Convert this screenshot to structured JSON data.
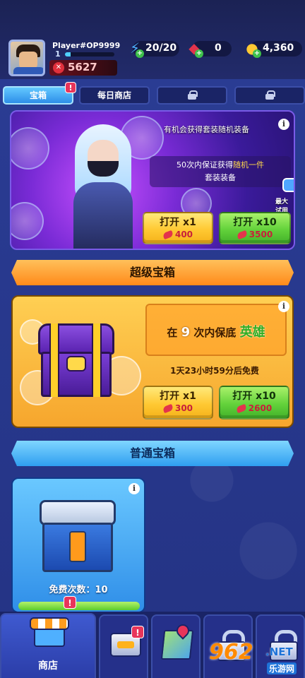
{
  "player": {
    "name": "Player#OP9999",
    "level": "1",
    "xp_fraction": 0.12,
    "power": "5627"
  },
  "resources": {
    "energy": "20/20",
    "gems": "0",
    "coins": "4,360"
  },
  "tabs": [
    {
      "label": "宝箱",
      "badge": "!",
      "active": true
    },
    {
      "label": "每日商店",
      "badge": "",
      "active": false
    },
    {
      "label": "",
      "locked": true
    },
    {
      "label": "",
      "locked": true
    }
  ],
  "hero_banner": {
    "note_top": "有机会获得套装随机装备",
    "note_line1_prefix": "50次内保证获得",
    "note_line1_highlight": "随机一件",
    "note_line2": "套装装备",
    "try_label": "最大试用",
    "open1": {
      "label": "打开 x1",
      "cost": "400"
    },
    "open10": {
      "label": "打开 x10",
      "cost": "3500"
    }
  },
  "super_chest": {
    "title": "超级宝箱",
    "guarantee_prefix": "在",
    "guarantee_num": "9",
    "guarantee_mid": "次内保底",
    "guarantee_reward": "英雄",
    "free_timer": "1天23小时59分后免费",
    "open1": {
      "label": "打开 x1",
      "cost": "300"
    },
    "open10": {
      "label": "打开 x10",
      "cost": "2600"
    }
  },
  "normal_chest": {
    "title": "普通宝箱",
    "free_count": "免费次数：10",
    "progress_fraction": 1.0
  },
  "bottom_nav": {
    "shop_label": "商店",
    "shop_badge": "!",
    "armory_badge": "!"
  },
  "watermark": {
    "brand": "962",
    "net": ".NET",
    "sub": "乐游网"
  },
  "colors": {
    "accent_yellow": "#ffc933",
    "accent_green": "#63d23b",
    "badge_red": "#e8355a",
    "gem_red": "#e3344c"
  }
}
